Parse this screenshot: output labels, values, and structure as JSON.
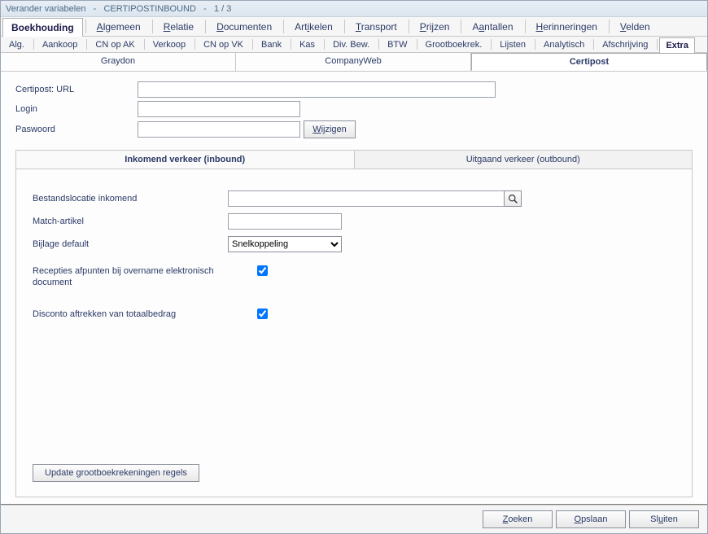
{
  "title": {
    "prefix": "Verander variabelen   -   ",
    "name": "CERTIPOSTINBOUND",
    "suffix": "   -   1 / 3"
  },
  "tabs1": [
    {
      "pre": "",
      "ul": "",
      "post": "Boekhouding",
      "active": true
    },
    {
      "pre": "",
      "ul": "A",
      "post": "lgemeen"
    },
    {
      "pre": "",
      "ul": "R",
      "post": "elatie"
    },
    {
      "pre": "",
      "ul": "D",
      "post": "ocumenten"
    },
    {
      "pre": "Art",
      "ul": "i",
      "post": "kelen"
    },
    {
      "pre": "",
      "ul": "T",
      "post": "ransport"
    },
    {
      "pre": "",
      "ul": "P",
      "post": "rijzen"
    },
    {
      "pre": "A",
      "ul": "a",
      "post": "ntallen"
    },
    {
      "pre": "",
      "ul": "H",
      "post": "erinneringen"
    },
    {
      "pre": "",
      "ul": "V",
      "post": "elden"
    }
  ],
  "tabs2": [
    {
      "label": "Alg."
    },
    {
      "label": "Aankoop"
    },
    {
      "label": "CN op AK"
    },
    {
      "label": "Verkoop"
    },
    {
      "label": "CN op VK"
    },
    {
      "label": "Bank"
    },
    {
      "label": "Kas"
    },
    {
      "label": "Div. Bew."
    },
    {
      "label": "BTW"
    },
    {
      "label": "Grootboekrek."
    },
    {
      "label": "Lijsten"
    },
    {
      "label": "Analytisch"
    },
    {
      "label": "Afschrijving"
    },
    {
      "label": "Extra",
      "active": true
    }
  ],
  "tabs3": [
    {
      "label": "Graydon"
    },
    {
      "label": "CompanyWeb"
    },
    {
      "label": "Certipost",
      "active": true
    }
  ],
  "certipost": {
    "url_label": "Certipost: URL",
    "url_value": "",
    "login_label": "Login",
    "login_value": "",
    "password_label": "Paswoord",
    "password_value": "",
    "wijzigen_pre": "",
    "wijzigen_ul": "W",
    "wijzigen_post": "ijzigen"
  },
  "group": {
    "tab_inbound": "Inkomend verkeer (inbound)",
    "tab_outbound": "Uitgaand verkeer (outbound)",
    "bestandslocatie_label": "Bestandslocatie inkomend",
    "bestandslocatie_value": "",
    "match_label": "Match-artikel",
    "match_value": "",
    "bijlage_label": "Bijlage default",
    "bijlage_value": "Snelkoppeling",
    "recepties_label": "Recepties afpunten bij overname elektronisch document",
    "disconto_label": "Disconto aftrekken van totaalbedrag",
    "update_btn": "Update grootboekrekeningen regels"
  },
  "footer": {
    "zoeken_ul": "Z",
    "zoeken_post": "oeken",
    "opslaan_ul": "O",
    "opslaan_post": "pslaan",
    "sluiten_pre": "Sl",
    "sluiten_ul": "u",
    "sluiten_post": "iten"
  }
}
